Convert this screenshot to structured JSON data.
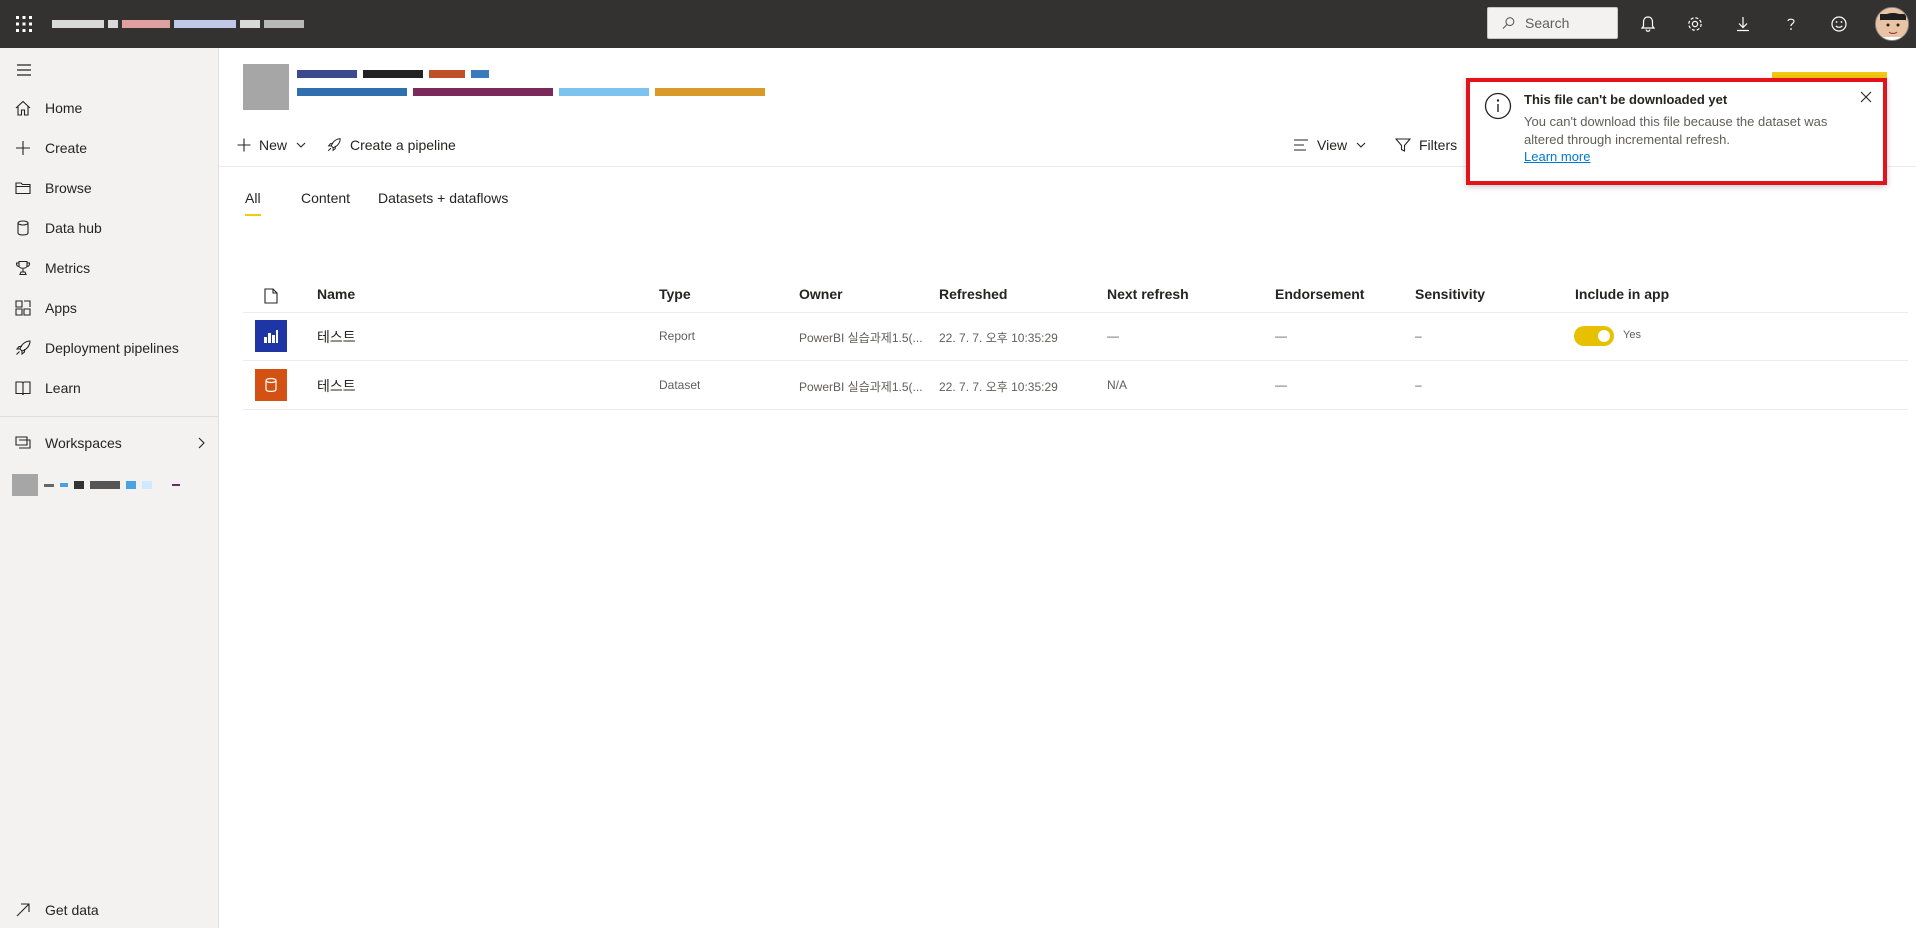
{
  "topbar": {
    "search_placeholder": "Search"
  },
  "sidebar": {
    "items": [
      {
        "label": "Home",
        "icon": "home-icon"
      },
      {
        "label": "Create",
        "icon": "plus-icon"
      },
      {
        "label": "Browse",
        "icon": "folder-icon"
      },
      {
        "label": "Data hub",
        "icon": "data-hub-icon"
      },
      {
        "label": "Metrics",
        "icon": "trophy-icon"
      },
      {
        "label": "Apps",
        "icon": "apps-icon"
      },
      {
        "label": "Deployment pipelines",
        "icon": "rocket-icon"
      },
      {
        "label": "Learn",
        "icon": "book-icon"
      }
    ],
    "workspaces_label": "Workspaces",
    "get_data_label": "Get data"
  },
  "toolbar": {
    "new_label": "New",
    "pipeline_label": "Create a pipeline",
    "view_label": "View",
    "filters_label": "Filters"
  },
  "tabs": [
    {
      "label": "All",
      "active": true
    },
    {
      "label": "Content",
      "active": false
    },
    {
      "label": "Datasets + dataflows",
      "active": false
    }
  ],
  "table": {
    "headers": {
      "name": "Name",
      "type": "Type",
      "owner": "Owner",
      "refreshed": "Refreshed",
      "next_refresh": "Next refresh",
      "endorsement": "Endorsement",
      "sensitivity": "Sensitivity",
      "include_in_app": "Include in app"
    },
    "rows": [
      {
        "name": "테스트",
        "type": "Report",
        "owner": "PowerBI 실습과제1.5(...",
        "refreshed": "22. 7. 7. 오후 10:35:29",
        "next_refresh": "—",
        "endorsement": "—",
        "sensitivity": "–",
        "include_in_app": "Yes",
        "icon": "report-icon",
        "icon_color": "#1d35a5"
      },
      {
        "name": "테스트",
        "type": "Dataset",
        "owner": "PowerBI 실습과제1.5(...",
        "refreshed": "22. 7. 7. 오후 10:35:29",
        "next_refresh": "N/A",
        "endorsement": "—",
        "sensitivity": "–",
        "include_in_app": "",
        "icon": "dataset-icon",
        "icon_color": "#d35213"
      }
    ]
  },
  "notification": {
    "title": "This file can't be downloaded yet",
    "message": "You can't download this file because the dataset was altered through incremental refresh.",
    "link": "Learn more",
    "border_color": "#e3121b"
  },
  "colors": {
    "topbar": "#333230",
    "accent": "#f2c811",
    "toggle_on": "#e7c000",
    "link": "#0078d4"
  }
}
